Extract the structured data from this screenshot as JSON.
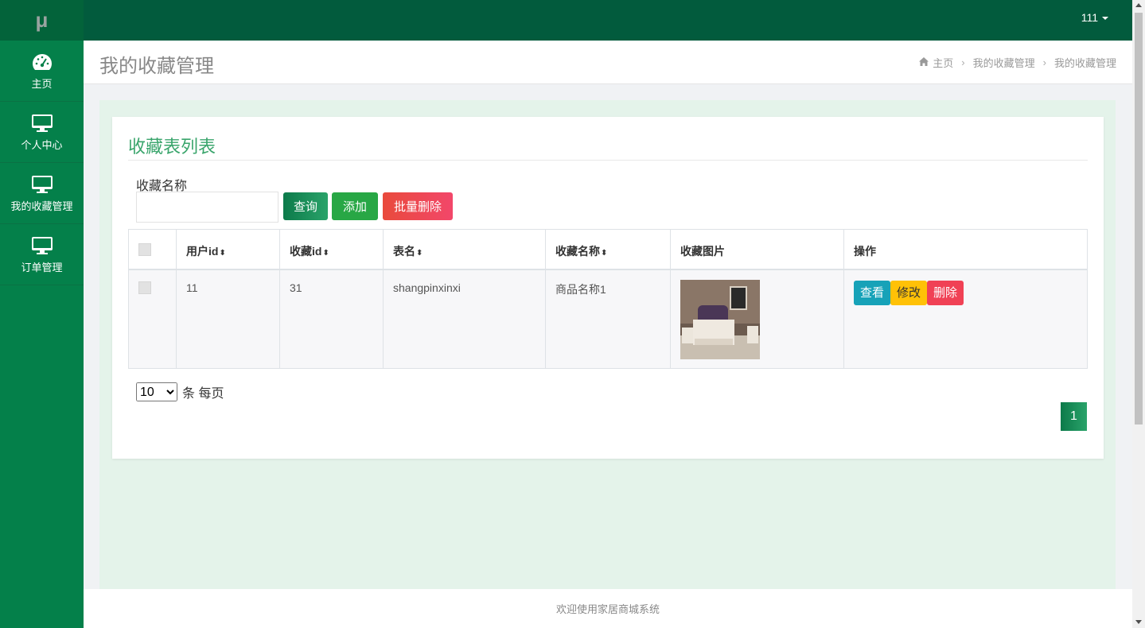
{
  "sidebar": {
    "logo": "μ",
    "items": [
      {
        "label": "主页",
        "icon": "dashboard-icon"
      },
      {
        "label": "个人中心",
        "icon": "monitor-icon"
      },
      {
        "label": "我的收藏管理",
        "icon": "monitor-icon"
      },
      {
        "label": "订单管理",
        "icon": "monitor-icon"
      }
    ]
  },
  "topbar": {
    "user": "111"
  },
  "header": {
    "title": "我的收藏管理",
    "breadcrumb": [
      "主页",
      "我的收藏管理",
      "我的收藏管理"
    ]
  },
  "card": {
    "title": "收藏表列表",
    "search_label": "收藏名称",
    "search_value": "",
    "buttons": {
      "query": "查询",
      "add": "添加",
      "batch_delete": "批量删除"
    }
  },
  "table": {
    "columns": [
      "用户id",
      "收藏id",
      "表名",
      "收藏名称",
      "收藏图片",
      "操作"
    ],
    "rows": [
      {
        "user_id": "11",
        "fav_id": "31",
        "table_name": "shangpinxinxi",
        "fav_name": "商品名称1",
        "image": "bedroom-furniture-photo"
      }
    ],
    "actions": {
      "view": "查看",
      "edit": "修改",
      "delete": "删除"
    }
  },
  "pagination": {
    "page_size": "10",
    "page_size_suffix": "条 每页",
    "current_page": "1"
  },
  "footer": {
    "text": "欢迎使用家居商城系统"
  },
  "colors": {
    "sidebar": "#04804a",
    "topbar": "#025b3d",
    "accent": "#3aa56c"
  }
}
